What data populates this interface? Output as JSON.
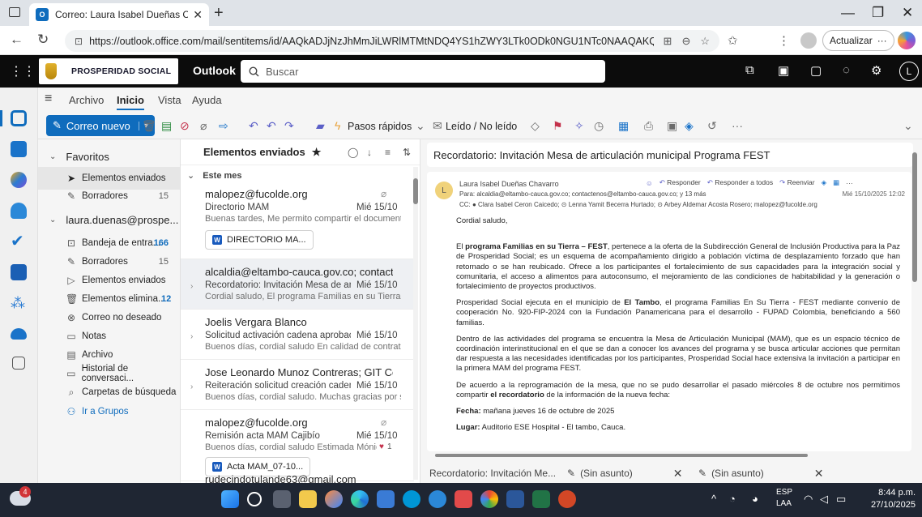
{
  "browser": {
    "tab_title": "Correo: Laura Isabel Dueñas Chav",
    "url": "https://outlook.office.com/mail/sentitems/id/AAQkADJjNzJhMmJiLWRlMTMtNDQ4YS1hZWY3LTk0ODk0NGU1NTc0NAAQAKQqLChd1kl...",
    "update_label": "Actualizar"
  },
  "topbar": {
    "brand": "PROSPERIDAD SOCIAL",
    "app": "Outlook",
    "search_placeholder": "Buscar",
    "avatar": "L"
  },
  "ribbon": {
    "tabs": [
      "Archivo",
      "Inicio",
      "Vista",
      "Ayuda"
    ],
    "new_mail": "Correo nuevo",
    "quick_steps": "Pasos rápidos",
    "read_unread": "Leído / No leído"
  },
  "folders": {
    "favorites_label": "Favoritos",
    "favorites": [
      {
        "label": "Elementos enviados",
        "count": ""
      },
      {
        "label": "Borradores",
        "count": "15"
      }
    ],
    "account": "laura.duenas@prospe...",
    "items": [
      {
        "label": "Bandeja de entra...",
        "count": "166"
      },
      {
        "label": "Borradores",
        "count": "15"
      },
      {
        "label": "Elementos enviados",
        "count": ""
      },
      {
        "label": "Elementos elimina...",
        "count": "12"
      },
      {
        "label": "Correo no deseado",
        "count": ""
      },
      {
        "label": "Notas",
        "count": ""
      },
      {
        "label": "Archivo",
        "count": ""
      },
      {
        "label": "Historial de conversaci...",
        "count": ""
      },
      {
        "label": "Carpetas de búsqueda",
        "count": ""
      }
    ],
    "groups_link": "Ir a Grupos"
  },
  "list": {
    "title": "Elementos enviados",
    "group": "Este mes",
    "messages": [
      {
        "from": "malopez@fucolde.org",
        "subject": "Directorio MAM",
        "date": "Mié 15/10",
        "preview": "Buenas tardes, Me permito compartir el documento ...",
        "attachment": "DIRECTORIO MA..."
      },
      {
        "from": "alcaldia@eltambo-cauca.gov.co; contacten...",
        "subject": "Recordatorio: Invitación Mesa de articul...",
        "date": "Mié 15/10",
        "preview": "Cordial saludo, El programa Familias en su Tierra – F...",
        "attachment": ""
      },
      {
        "from": "Joelis Vergara Blanco",
        "subject": "Solicitud activación cadena aprobación ...",
        "date": "Mié 15/10",
        "preview": "Buenos días, cordial saludo En calidad de contratista ...",
        "attachment": ""
      },
      {
        "from": "Jose Leonardo Munoz Contreras; GIT Comis...",
        "subject": "Reiteración solicitud creación cadena d...",
        "date": "Mié 15/10",
        "preview": "Buenos días, cordial saludo. Muchas gracias por su a...",
        "attachment": ""
      },
      {
        "from": "malopez@fucolde.org",
        "subject": "Remisión acta MAM Cajibío",
        "date": "Mié 15/10",
        "preview": "Buenos días, cordial saludo Estimada Mónica, R...",
        "attachment": "Acta MAM_07-10...",
        "reaction": "1"
      },
      {
        "from": "rudecindotulande63@gmail.com",
        "subject": "",
        "date": "",
        "preview": "",
        "attachment": ""
      }
    ]
  },
  "reading": {
    "subject": "Recordatorio: Invitación Mesa de articulación municipal Programa FEST",
    "sender": "Laura Isabel Dueñas Chavarro",
    "sender_initial": "L",
    "to": "Para: alcaldia@eltambo-cauca.gov.co; contactenos@eltambo-cauca.gov.co; y 13 más",
    "cc": "CC: ● Clara Isabel Ceron Caicedo; ⊙ Lenna Yamit Becerra Hurtado; ⊙ Arbey Aldemar Acosta Rosero; malopez@fucolde.org",
    "date": "Mié 15/10/2025 12:02",
    "actions": {
      "reply": "Responder",
      "reply_all": "Responder a todos",
      "forward": "Reenviar"
    },
    "greeting": "Cordial saludo,",
    "p1_pre": "El ",
    "p1_bold": "programa Familias en su Tierra – FEST",
    "p1_post": ", pertenece a la oferta de la Subdirección General de Inclusión Productiva para la Paz de Prosperidad Social; es un esquema de acompañamiento dirigido a población víctima de desplazamiento forzado que han retornado o se han reubicado. Ofrece a los participantes el fortalecimiento de sus capacidades para la integración social y comunitaria, el acceso a alimentos para autoconsumo, el mejoramiento de las condiciones de habitabilidad y la generación o fortalecimiento de proyectos productivos.",
    "p2_pre": "Prosperidad Social ejecuta en el municipio de ",
    "p2_bold": "El Tambo",
    "p2_post": ", el programa Familias En Su Tierra - FEST mediante convenio de cooperación No. 920-FIP-2024 con la Fundación Panamericana para el desarrollo - FUPAD Colombia, beneficiando a 560 familias.",
    "p3": "Dentro de las actividades del programa se encuentra la Mesa de Articulación Municipal (MAM), que es un espacio técnico de coordinación interinstitucional en el que se dan a conocer los avances del programa y se busca articular acciones que permitan dar respuesta a las necesidades identificadas por los participantes, Prosperidad Social hace extensiva la invitación a participar en la primera MAM del programa FEST.",
    "p4_pre": "De acuerdo a la reprogramación de la mesa, que no se pudo desarrollar el pasado miércoles 8 de octubre nos permitimos compartir ",
    "p4_bold": "el recordatorio",
    "p4_post": " de la información de la nueva fecha:",
    "fecha_label": "Fecha:",
    "fecha_value": " mañana jueves 16 de octubre de 2025",
    "lugar_label": "Lugar:",
    "lugar_value": " Auditorio ESE Hospital - El tambo, Cauca."
  },
  "drafts": [
    "Recordatorio: Invitación Me...",
    "(Sin asunto)",
    "(Sin asunto)"
  ],
  "taskbar": {
    "weather_badge": "4",
    "lang1": "ESP",
    "lang2": "LAA",
    "time": "8:44 p.m.",
    "date": "27/10/2025"
  }
}
